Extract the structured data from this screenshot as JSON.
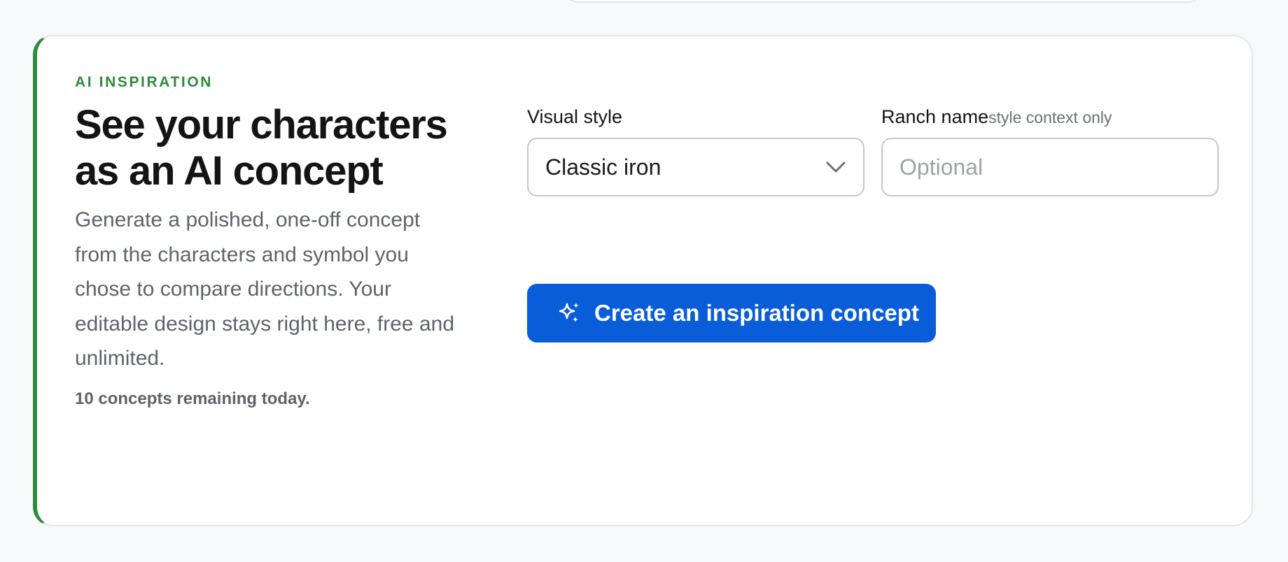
{
  "ai_inspiration": {
    "eyebrow": "AI INSPIRATION",
    "headline_line1": "See your characters",
    "headline_line2": "as an AI concept",
    "description": "Generate a polished, one-off concept from the characters and symbol you chose to compare directions. Your editable design stays right here, free and unlimited.",
    "remaining": "10 concepts remaining today.",
    "visual_style": {
      "label": "Visual style",
      "value": "Classic iron"
    },
    "ranch_name": {
      "label": "Ranch name",
      "hint": "style context only",
      "value": "",
      "placeholder": "Optional"
    },
    "create_button_label": "Create an inspiration concept",
    "icons": {
      "button_icon": "sparkle-icon",
      "select_icon": "chevron-down-icon"
    }
  },
  "colors": {
    "accent_green": "#2e8b3d",
    "primary_blue": "#0a5dd8",
    "muted_text": "#5d636c",
    "page_background": "#f8f9fb"
  }
}
